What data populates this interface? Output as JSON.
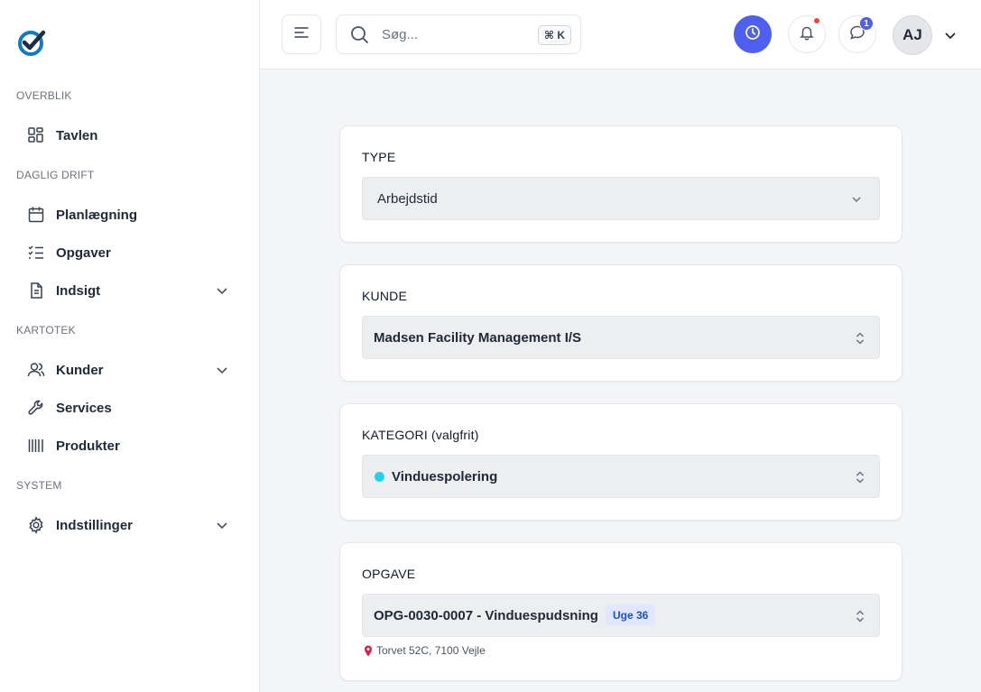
{
  "sidebar": {
    "sections": [
      {
        "label": "OVERBLIK"
      },
      {
        "label": "DAGLIG DRIFT"
      },
      {
        "label": "KARTOTEK"
      },
      {
        "label": "SYSTEM"
      }
    ],
    "items": [
      {
        "label": "Tavlen",
        "icon": "grid-icon"
      },
      {
        "label": "Planlægning",
        "icon": "calendar-icon"
      },
      {
        "label": "Opgaver",
        "icon": "checklist-icon"
      },
      {
        "label": "Indsigt",
        "icon": "document-icon"
      },
      {
        "label": "Kunder",
        "icon": "users-icon"
      },
      {
        "label": "Services",
        "icon": "wrench-icon"
      },
      {
        "label": "Produkter",
        "icon": "barcode-icon"
      },
      {
        "label": "Indstillinger",
        "icon": "gear-icon"
      }
    ]
  },
  "header": {
    "search_placeholder": "Søg...",
    "shortcut": "⌘ K",
    "chat_badge": "1",
    "avatar_initials": "AJ",
    "accent_color": "#4f5ff0"
  },
  "form": {
    "type": {
      "label": "TYPE",
      "value": "Arbejdstid"
    },
    "customer": {
      "label": "KUNDE",
      "value": "Madsen Facility Management I/S"
    },
    "category": {
      "label": "KATEGORI (valgfrit)",
      "value": "Vinduespolering",
      "dot_color": "#22d3ee"
    },
    "task": {
      "label": "OPGAVE",
      "value": "OPG-0030-0007 - Vinduespudsning",
      "week": "Uge 36",
      "address": "Torvet 52C, 7100 Vejle"
    }
  }
}
